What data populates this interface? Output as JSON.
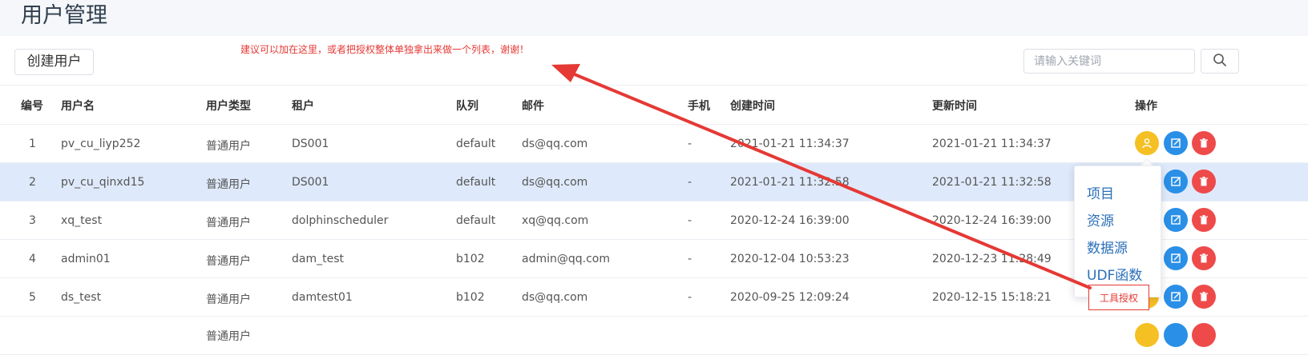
{
  "page": {
    "title": "用户管理"
  },
  "toolbar": {
    "create_label": "创建用户",
    "search_placeholder": "请输入关键词",
    "search_icon": "search-icon"
  },
  "annotation": {
    "note": "建议可以加在这里，或者把授权整体单独拿出来做一个列表，谢谢！",
    "tool_label": "工具授权",
    "color": "#e53935"
  },
  "table": {
    "headers": {
      "id": "编号",
      "name": "用户名",
      "type": "用户类型",
      "tenant": "租户",
      "queue": "队列",
      "email": "邮件",
      "phone": "手机",
      "created": "创建时间",
      "updated": "更新时间",
      "ops": "操作"
    },
    "rows": [
      {
        "id": "1",
        "name": "pv_cu_liyp252",
        "type": "普通用户",
        "tenant": "DS001",
        "queue": "default",
        "email": "ds@qq.com",
        "phone": "-",
        "created": "2021-01-21 11:34:37",
        "updated": "2021-01-21 11:34:37"
      },
      {
        "id": "2",
        "name": "pv_cu_qinxd15",
        "type": "普通用户",
        "tenant": "DS001",
        "queue": "default",
        "email": "ds@qq.com",
        "phone": "-",
        "created": "2021-01-21 11:32:58",
        "updated": "2021-01-21 11:32:58"
      },
      {
        "id": "3",
        "name": "xq_test",
        "type": "普通用户",
        "tenant": "dolphinscheduler",
        "queue": "default",
        "email": "xq@qq.com",
        "phone": "-",
        "created": "2020-12-24 16:39:00",
        "updated": "2020-12-24 16:39:00"
      },
      {
        "id": "4",
        "name": "admin01",
        "type": "普通用户",
        "tenant": "dam_test",
        "queue": "b102",
        "email": "admin@qq.com",
        "phone": "-",
        "created": "2020-12-04 10:53:23",
        "updated": "2020-12-23 11:28:49"
      },
      {
        "id": "5",
        "name": "ds_test",
        "type": "普通用户",
        "tenant": "damtest01",
        "queue": "b102",
        "email": "ds@qq.com",
        "phone": "-",
        "created": "2020-09-25 12:09:24",
        "updated": "2020-12-15 15:18:21"
      }
    ],
    "row6_type": "普通用户"
  },
  "popover": {
    "items": [
      "项目",
      "资源",
      "数据源",
      "UDF函数"
    ]
  },
  "colors": {
    "auth": "#f5c024",
    "edit": "#2a8fe6",
    "delete": "#ef4a4a",
    "highlight_row": "#deeafb",
    "link": "#2a6fb8"
  }
}
